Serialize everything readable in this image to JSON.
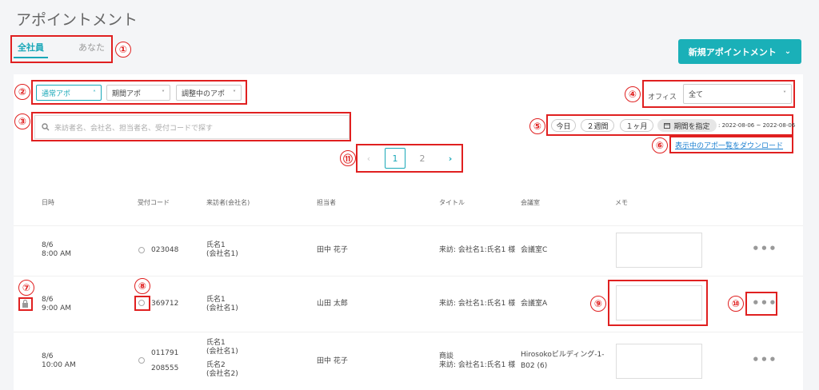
{
  "page_title": "アポイントメント",
  "tabs": [
    {
      "label": "全社員",
      "active": true
    },
    {
      "label": "あなた",
      "active": false
    }
  ],
  "new_button": {
    "label": "新規アポイントメント",
    "icon": "chevron-down-icon"
  },
  "filters": {
    "type_dropdowns": [
      {
        "label": "通常アポ",
        "icon": "chevron-up-icon"
      },
      {
        "label": "期間アポ",
        "icon": "chevron-down-icon"
      },
      {
        "label": "調整中のアポ",
        "icon": "chevron-down-icon"
      }
    ],
    "office_label": "オフィス",
    "office_value": "全て"
  },
  "search": {
    "placeholder": "来訪者名、会社名、担当者名、受付コードで探す",
    "icon": "search-icon"
  },
  "date_filters": {
    "today": "今日",
    "two_weeks": "２週間",
    "one_month": "１ヶ月",
    "custom": "期間を指定",
    "range": ": 2022-08-06 ~ 2022-08-06"
  },
  "download_link": "表示中のアポ一覧をダウンロード",
  "pagination": {
    "prev": "‹",
    "pages": [
      "1",
      "2"
    ],
    "current": "1",
    "next": "›"
  },
  "table": {
    "headers": [
      "日時",
      "受付コード",
      "来訪者(会社名)",
      "担当者",
      "タイトル",
      "会議室",
      "メモ"
    ],
    "rows": [
      {
        "date": "8/6",
        "time": "8:00 AM",
        "codes": [
          "023048"
        ],
        "visitors": [
          {
            "name": "氏名1",
            "company": "(会社名1)"
          }
        ],
        "host": "田中 花子",
        "titles": [
          "来訪: 会社名1:氏名1 様"
        ],
        "room": "会議室C",
        "locked": false
      },
      {
        "date": "8/6",
        "time": "9:00 AM",
        "codes": [
          "369712"
        ],
        "visitors": [
          {
            "name": "氏名1",
            "company": "(会社名1)"
          }
        ],
        "host": "山田 太郎",
        "titles": [
          "来訪: 会社名1:氏名1 様"
        ],
        "room": "会議室A",
        "locked": true
      },
      {
        "date": "8/6",
        "time": "10:00 AM",
        "codes": [
          "011791",
          "208555"
        ],
        "visitors": [
          {
            "name": "氏名1",
            "company": "(会社名1)"
          },
          {
            "name": "氏名2",
            "company": "(会社名2)"
          }
        ],
        "host": "田中 花子",
        "titles": [
          "商談",
          "来訪: 会社名1:氏名1 様"
        ],
        "room": "Hirosokoビルディング-1-B02 (6)",
        "locked": false
      }
    ],
    "more_label": "•••"
  },
  "annotations": [
    "①",
    "②",
    "③",
    "④",
    "⑤",
    "⑥",
    "⑦",
    "⑧",
    "⑨",
    "⑩",
    "⑪"
  ],
  "colors": {
    "accent": "#1ab0b8",
    "annotation": "#e02020",
    "link": "#1a7fd0"
  }
}
